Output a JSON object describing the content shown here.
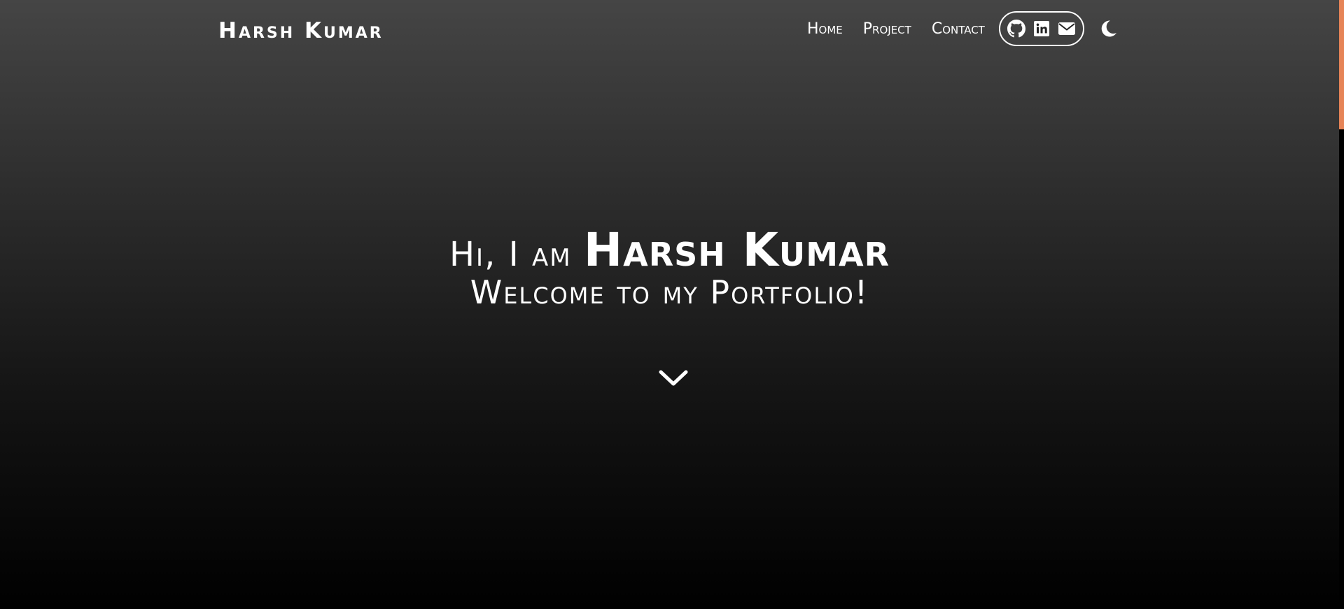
{
  "header": {
    "brand": "Harsh Kumar",
    "nav": [
      "Home",
      "Project",
      "Contact"
    ],
    "social_icons": [
      "github-icon",
      "linkedin-icon",
      "envelope-icon"
    ],
    "theme_icon": "moon-icon"
  },
  "hero": {
    "greeting": "Hi, I am",
    "name": "Harsh Kumar",
    "welcome": "Welcome to my Portfolio!",
    "scroll_icon": "chevron-down-icon"
  },
  "colors": {
    "background_top": "#454545",
    "background_bottom": "#000000",
    "text": "#ffffff",
    "scroll_thumb": "#e68457"
  }
}
